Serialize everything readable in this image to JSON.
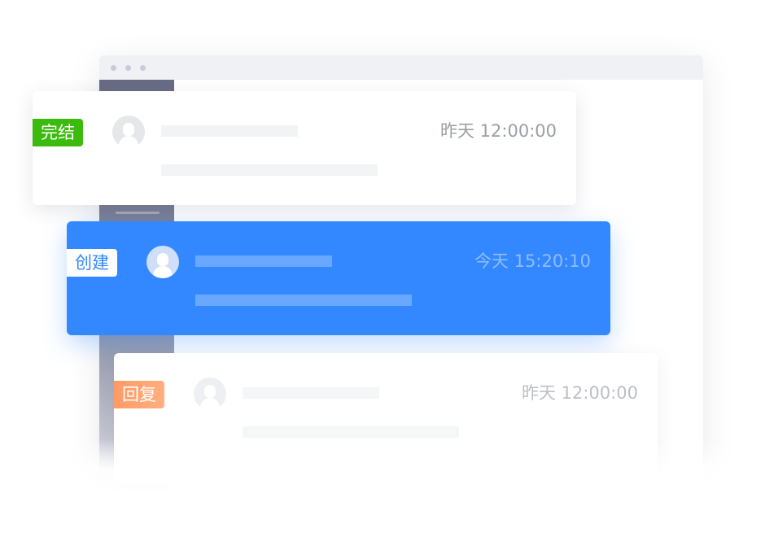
{
  "cards": [
    {
      "tag": "完结",
      "time": "昨天 12:00:00",
      "tag_color": "#3cbb0f"
    },
    {
      "tag": "创建",
      "time": "今天 15:20:10",
      "tag_color": "#3388ff",
      "card_color": "#3388ff"
    },
    {
      "tag": "回复",
      "time": "昨天 12:00:00",
      "tag_color": "#ff9a66"
    }
  ],
  "icons": {
    "avatar": "user-avatar-icon",
    "window_dots": "window-control-dots"
  }
}
